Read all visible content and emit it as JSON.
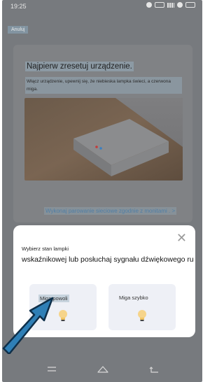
{
  "status_bar": {
    "time": "19:25",
    "icons": [
      "alarm-icon",
      "message-icon",
      "signal-4g-icon",
      "wifi-icon",
      "battery-icon"
    ]
  },
  "header": {
    "cancel_label": "Anuluj"
  },
  "card": {
    "title": "Najpierw zresetuj urządzenie.",
    "description": "Włącz urządzenie, upewnij się, że niebieska lampka świeci, a czerwona miga.",
    "link": "Wykonaj parowanie sieciowe zgodnie z monitami . >"
  },
  "sheet": {
    "line1": "Wybierz stan lampki",
    "line2": "wskaźnikowej lub posłuchaj sygnału dźwiękowego ru",
    "options": [
      {
        "label": "Miga powoli"
      },
      {
        "label": "Miga szybko"
      }
    ],
    "close_icon": "close-icon"
  },
  "nav": {
    "icons": [
      "menu-icon",
      "home-icon",
      "back-icon"
    ]
  },
  "colors": {
    "overlay": "#777a7e",
    "sheet_bg": "#ffffff",
    "option_bg": "#eef0f6",
    "link": "#4f7ea6",
    "arrow": "#2f7fb6",
    "bulb": "#f6d48a"
  }
}
